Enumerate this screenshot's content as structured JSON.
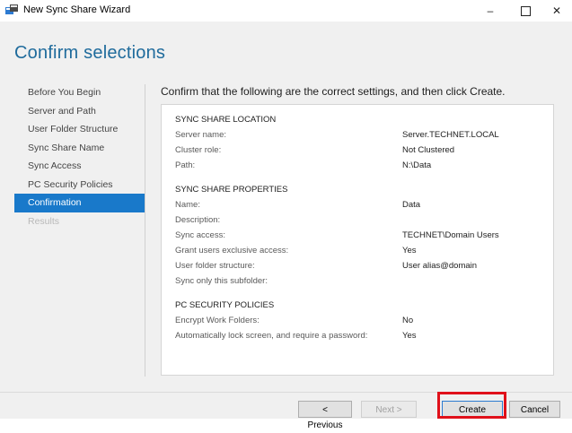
{
  "window": {
    "title": "New Sync Share Wizard",
    "minimize_glyph": "–",
    "close_glyph": "✕"
  },
  "page": {
    "heading": "Confirm selections",
    "instruction": "Confirm that the following are the correct settings, and then click Create."
  },
  "nav": {
    "items": [
      {
        "label": "Before You Begin",
        "state": "normal"
      },
      {
        "label": "Server and Path",
        "state": "normal"
      },
      {
        "label": "User Folder Structure",
        "state": "normal"
      },
      {
        "label": "Sync Share Name",
        "state": "normal"
      },
      {
        "label": "Sync Access",
        "state": "normal"
      },
      {
        "label": "PC Security Policies",
        "state": "normal"
      },
      {
        "label": "Confirmation",
        "state": "active"
      },
      {
        "label": "Results",
        "state": "disabled"
      }
    ],
    "active_color": "#1979ca"
  },
  "sections": {
    "location": {
      "title": "SYNC SHARE LOCATION",
      "rows": [
        {
          "label": "Server name:",
          "value": "Server.TECHNET.LOCAL"
        },
        {
          "label": "Cluster role:",
          "value": "Not Clustered"
        },
        {
          "label": "Path:",
          "value": "N:\\Data"
        }
      ]
    },
    "properties": {
      "title": "SYNC SHARE PROPERTIES",
      "rows": [
        {
          "label": "Name:",
          "value": "Data"
        },
        {
          "label": "Description:",
          "value": ""
        },
        {
          "label": "Sync access:",
          "value": "TECHNET\\Domain Users"
        },
        {
          "label": "Grant users exclusive access:",
          "value": "Yes"
        },
        {
          "label": "User folder structure:",
          "value": "User alias@domain"
        },
        {
          "label": "Sync only this subfolder:",
          "value": ""
        }
      ]
    },
    "policies": {
      "title": "PC SECURITY POLICIES",
      "rows": [
        {
          "label": "Encrypt Work Folders:",
          "value": "No"
        },
        {
          "label": "Automatically lock screen, and require a password:",
          "value": "Yes"
        }
      ]
    }
  },
  "buttons": {
    "previous": "< Previous",
    "next": "Next >",
    "create": "Create",
    "cancel": "Cancel"
  },
  "colors": {
    "heading": "#1f6b9c",
    "highlight": "#e0101a"
  }
}
